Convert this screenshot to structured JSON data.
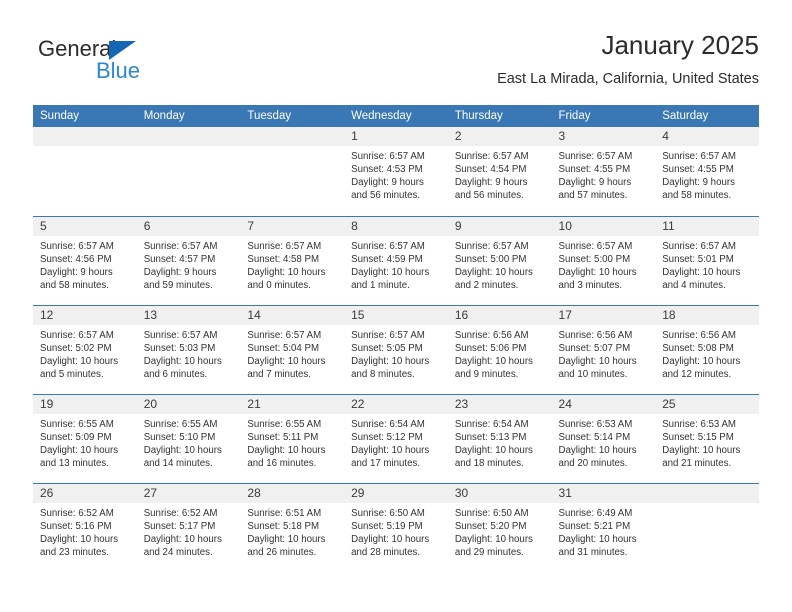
{
  "branding": {
    "logo_primary": "General",
    "logo_secondary": "Blue",
    "triangle_color": "#1567b3",
    "blue_text_color": "#2a87d6"
  },
  "header": {
    "title": "January 2025",
    "subtitle": "East La Mirada, California, United States",
    "header_bg_color": "#3a77b5",
    "daynum_bg_color": "#f0f0f0"
  },
  "weekday_headers": [
    "Sunday",
    "Monday",
    "Tuesday",
    "Wednesday",
    "Thursday",
    "Friday",
    "Saturday"
  ],
  "labels": {
    "sunrise_prefix": "Sunrise:",
    "sunset_prefix": "Sunset:",
    "daylight_prefix": "Daylight:"
  },
  "weeks": [
    [
      {
        "day": "",
        "empty": true
      },
      {
        "day": "",
        "empty": true
      },
      {
        "day": "",
        "empty": true
      },
      {
        "day": "1",
        "sunrise": "Sunrise: 6:57 AM",
        "sunset": "Sunset: 4:53 PM",
        "daylight_1": "Daylight: 9 hours",
        "daylight_2": "and 56 minutes."
      },
      {
        "day": "2",
        "sunrise": "Sunrise: 6:57 AM",
        "sunset": "Sunset: 4:54 PM",
        "daylight_1": "Daylight: 9 hours",
        "daylight_2": "and 56 minutes."
      },
      {
        "day": "3",
        "sunrise": "Sunrise: 6:57 AM",
        "sunset": "Sunset: 4:55 PM",
        "daylight_1": "Daylight: 9 hours",
        "daylight_2": "and 57 minutes."
      },
      {
        "day": "4",
        "sunrise": "Sunrise: 6:57 AM",
        "sunset": "Sunset: 4:55 PM",
        "daylight_1": "Daylight: 9 hours",
        "daylight_2": "and 58 minutes."
      }
    ],
    [
      {
        "day": "5",
        "sunrise": "Sunrise: 6:57 AM",
        "sunset": "Sunset: 4:56 PM",
        "daylight_1": "Daylight: 9 hours",
        "daylight_2": "and 58 minutes."
      },
      {
        "day": "6",
        "sunrise": "Sunrise: 6:57 AM",
        "sunset": "Sunset: 4:57 PM",
        "daylight_1": "Daylight: 9 hours",
        "daylight_2": "and 59 minutes."
      },
      {
        "day": "7",
        "sunrise": "Sunrise: 6:57 AM",
        "sunset": "Sunset: 4:58 PM",
        "daylight_1": "Daylight: 10 hours",
        "daylight_2": "and 0 minutes."
      },
      {
        "day": "8",
        "sunrise": "Sunrise: 6:57 AM",
        "sunset": "Sunset: 4:59 PM",
        "daylight_1": "Daylight: 10 hours",
        "daylight_2": "and 1 minute."
      },
      {
        "day": "9",
        "sunrise": "Sunrise: 6:57 AM",
        "sunset": "Sunset: 5:00 PM",
        "daylight_1": "Daylight: 10 hours",
        "daylight_2": "and 2 minutes."
      },
      {
        "day": "10",
        "sunrise": "Sunrise: 6:57 AM",
        "sunset": "Sunset: 5:00 PM",
        "daylight_1": "Daylight: 10 hours",
        "daylight_2": "and 3 minutes."
      },
      {
        "day": "11",
        "sunrise": "Sunrise: 6:57 AM",
        "sunset": "Sunset: 5:01 PM",
        "daylight_1": "Daylight: 10 hours",
        "daylight_2": "and 4 minutes."
      }
    ],
    [
      {
        "day": "12",
        "sunrise": "Sunrise: 6:57 AM",
        "sunset": "Sunset: 5:02 PM",
        "daylight_1": "Daylight: 10 hours",
        "daylight_2": "and 5 minutes."
      },
      {
        "day": "13",
        "sunrise": "Sunrise: 6:57 AM",
        "sunset": "Sunset: 5:03 PM",
        "daylight_1": "Daylight: 10 hours",
        "daylight_2": "and 6 minutes."
      },
      {
        "day": "14",
        "sunrise": "Sunrise: 6:57 AM",
        "sunset": "Sunset: 5:04 PM",
        "daylight_1": "Daylight: 10 hours",
        "daylight_2": "and 7 minutes."
      },
      {
        "day": "15",
        "sunrise": "Sunrise: 6:57 AM",
        "sunset": "Sunset: 5:05 PM",
        "daylight_1": "Daylight: 10 hours",
        "daylight_2": "and 8 minutes."
      },
      {
        "day": "16",
        "sunrise": "Sunrise: 6:56 AM",
        "sunset": "Sunset: 5:06 PM",
        "daylight_1": "Daylight: 10 hours",
        "daylight_2": "and 9 minutes."
      },
      {
        "day": "17",
        "sunrise": "Sunrise: 6:56 AM",
        "sunset": "Sunset: 5:07 PM",
        "daylight_1": "Daylight: 10 hours",
        "daylight_2": "and 10 minutes."
      },
      {
        "day": "18",
        "sunrise": "Sunrise: 6:56 AM",
        "sunset": "Sunset: 5:08 PM",
        "daylight_1": "Daylight: 10 hours",
        "daylight_2": "and 12 minutes."
      }
    ],
    [
      {
        "day": "19",
        "sunrise": "Sunrise: 6:55 AM",
        "sunset": "Sunset: 5:09 PM",
        "daylight_1": "Daylight: 10 hours",
        "daylight_2": "and 13 minutes."
      },
      {
        "day": "20",
        "sunrise": "Sunrise: 6:55 AM",
        "sunset": "Sunset: 5:10 PM",
        "daylight_1": "Daylight: 10 hours",
        "daylight_2": "and 14 minutes."
      },
      {
        "day": "21",
        "sunrise": "Sunrise: 6:55 AM",
        "sunset": "Sunset: 5:11 PM",
        "daylight_1": "Daylight: 10 hours",
        "daylight_2": "and 16 minutes."
      },
      {
        "day": "22",
        "sunrise": "Sunrise: 6:54 AM",
        "sunset": "Sunset: 5:12 PM",
        "daylight_1": "Daylight: 10 hours",
        "daylight_2": "and 17 minutes."
      },
      {
        "day": "23",
        "sunrise": "Sunrise: 6:54 AM",
        "sunset": "Sunset: 5:13 PM",
        "daylight_1": "Daylight: 10 hours",
        "daylight_2": "and 18 minutes."
      },
      {
        "day": "24",
        "sunrise": "Sunrise: 6:53 AM",
        "sunset": "Sunset: 5:14 PM",
        "daylight_1": "Daylight: 10 hours",
        "daylight_2": "and 20 minutes."
      },
      {
        "day": "25",
        "sunrise": "Sunrise: 6:53 AM",
        "sunset": "Sunset: 5:15 PM",
        "daylight_1": "Daylight: 10 hours",
        "daylight_2": "and 21 minutes."
      }
    ],
    [
      {
        "day": "26",
        "sunrise": "Sunrise: 6:52 AM",
        "sunset": "Sunset: 5:16 PM",
        "daylight_1": "Daylight: 10 hours",
        "daylight_2": "and 23 minutes."
      },
      {
        "day": "27",
        "sunrise": "Sunrise: 6:52 AM",
        "sunset": "Sunset: 5:17 PM",
        "daylight_1": "Daylight: 10 hours",
        "daylight_2": "and 24 minutes."
      },
      {
        "day": "28",
        "sunrise": "Sunrise: 6:51 AM",
        "sunset": "Sunset: 5:18 PM",
        "daylight_1": "Daylight: 10 hours",
        "daylight_2": "and 26 minutes."
      },
      {
        "day": "29",
        "sunrise": "Sunrise: 6:50 AM",
        "sunset": "Sunset: 5:19 PM",
        "daylight_1": "Daylight: 10 hours",
        "daylight_2": "and 28 minutes."
      },
      {
        "day": "30",
        "sunrise": "Sunrise: 6:50 AM",
        "sunset": "Sunset: 5:20 PM",
        "daylight_1": "Daylight: 10 hours",
        "daylight_2": "and 29 minutes."
      },
      {
        "day": "31",
        "sunrise": "Sunrise: 6:49 AM",
        "sunset": "Sunset: 5:21 PM",
        "daylight_1": "Daylight: 10 hours",
        "daylight_2": "and 31 minutes."
      },
      {
        "day": "",
        "empty": true
      }
    ]
  ]
}
